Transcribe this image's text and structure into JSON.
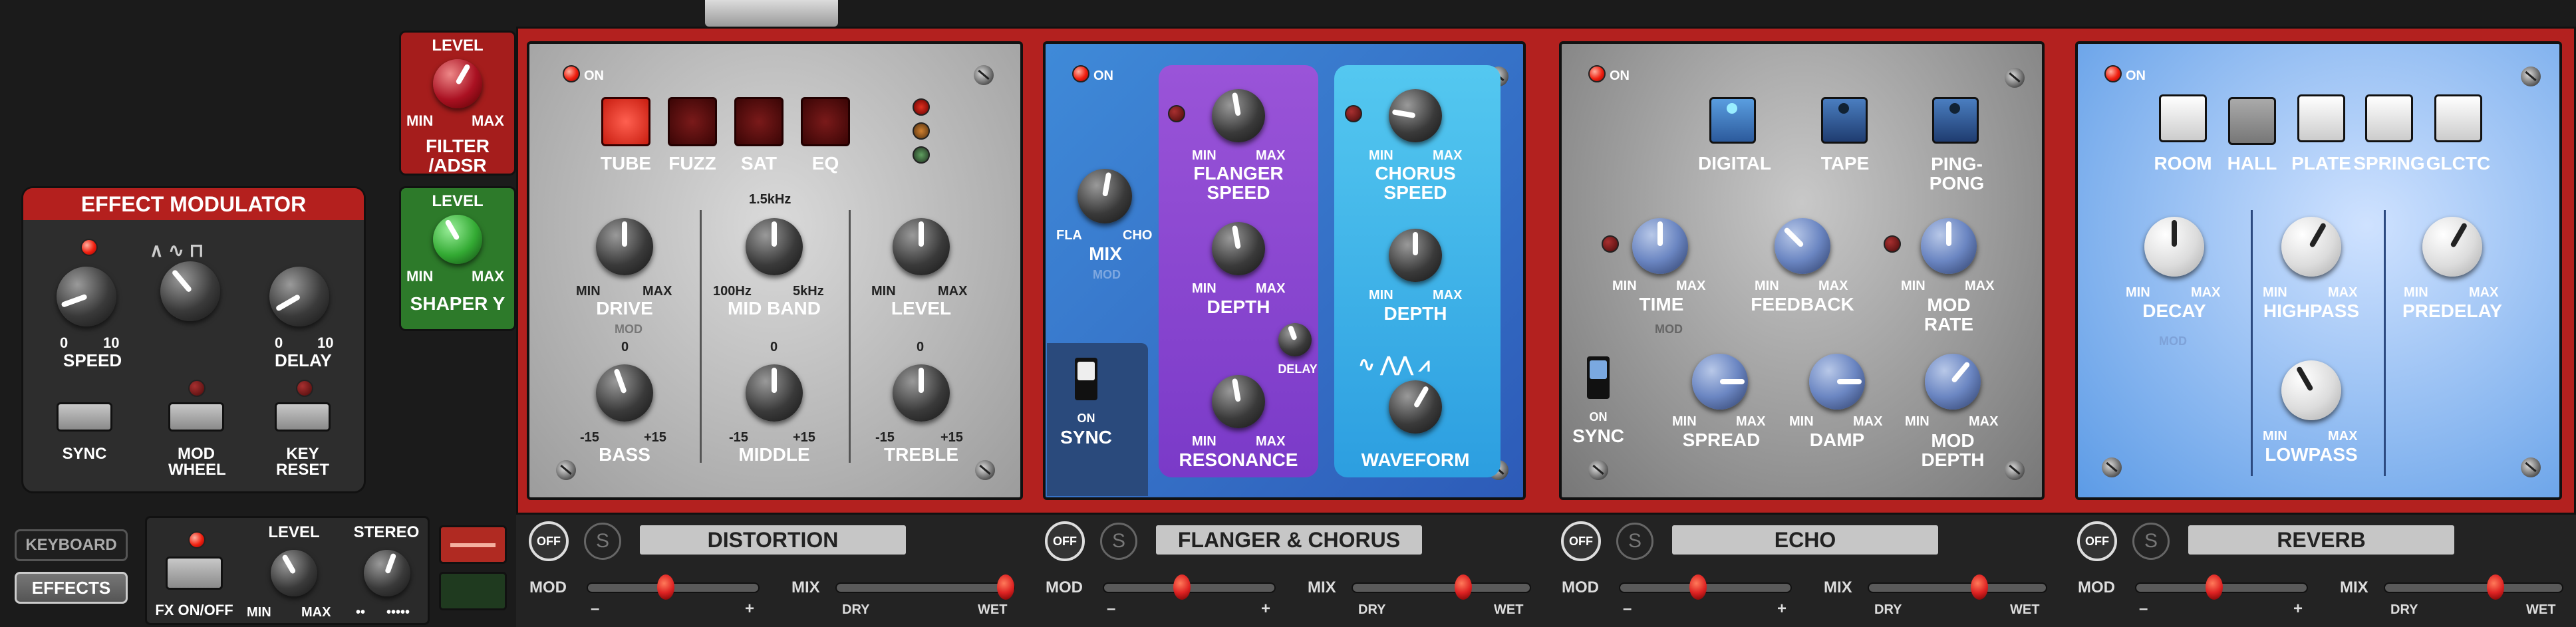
{
  "effect_modulator": {
    "title": "EFFECT MODULATOR",
    "speed_label": "SPEED",
    "speed_min": "0",
    "speed_max": "10",
    "delay_label": "DELAY",
    "delay_min": "0",
    "delay_max": "10",
    "sync_label": "SYNC",
    "mod_wheel_label": "MOD\nWHEEL",
    "key_reset_label": "KEY\nRESET"
  },
  "filter_adsr": {
    "level_label": "LEVEL",
    "min": "MIN",
    "max": "MAX",
    "title": "FILTER\n/ADSR"
  },
  "shaper_y": {
    "level_label": "LEVEL",
    "min": "MIN",
    "max": "MAX",
    "title": "SHAPER Y"
  },
  "left_nav": {
    "keyboard": "KEYBOARD",
    "effects": "EFFECTS"
  },
  "bottom_left": {
    "fx_on_off": "FX ON/OFF",
    "level": "LEVEL",
    "stereo": "STEREO",
    "min": "MIN",
    "max": "MAX",
    "stereo_left": "••",
    "stereo_right": "•••••"
  },
  "common": {
    "on": "ON",
    "off": "OFF",
    "s": "S",
    "mod": "MOD",
    "mix": "MIX",
    "dry": "DRY",
    "wet": "WET",
    "min": "MIN",
    "max": "MAX",
    "minus": "–",
    "plus": "+"
  },
  "distortion": {
    "name": "DISTORTION",
    "types": [
      "TUBE",
      "FUZZ",
      "SAT",
      "EQ"
    ],
    "drive": "DRIVE",
    "mid_band": "MID BAND",
    "mid_freq": "1.5kHz",
    "mid_lo": "100Hz",
    "mid_hi": "5kHz",
    "level": "LEVEL",
    "bass": "BASS",
    "middle": "MIDDLE",
    "treble": "TREBLE",
    "eq_zero": "0",
    "eq_min": "-15",
    "eq_max": "+15",
    "mod_tag": "MOD"
  },
  "flanger": {
    "name": "FLANGER & CHORUS",
    "mix": "MIX",
    "fla": "FLA",
    "cho": "CHO",
    "mod_tag": "MOD",
    "sync": "SYNC",
    "sync_on": "ON",
    "flanger_speed": "FLANGER\nSPEED",
    "depth": "DEPTH",
    "delay": "DELAY",
    "resonance": "RESONANCE",
    "chorus_speed": "CHORUS\nSPEED",
    "chorus_depth": "DEPTH",
    "waveform": "WAVEFORM"
  },
  "echo": {
    "name": "ECHO",
    "modes": [
      "DIGITAL",
      "TAPE",
      "PING-\nPONG"
    ],
    "time": "TIME",
    "feedback": "FEEDBACK",
    "mod_rate": "MOD\nRATE",
    "spread": "SPREAD",
    "damp": "DAMP",
    "mod_depth": "MOD\nDEPTH",
    "sync": "SYNC",
    "sync_on": "ON",
    "mod_tag": "MOD"
  },
  "reverb": {
    "name": "REVERB",
    "types": [
      "ROOM",
      "HALL",
      "PLATE",
      "SPRING",
      "GLCTC"
    ],
    "decay": "DECAY",
    "highpass": "HIGHPASS",
    "predelay": "PREDELAY",
    "lowpass": "LOWPASS",
    "mod_tag": "MOD"
  }
}
